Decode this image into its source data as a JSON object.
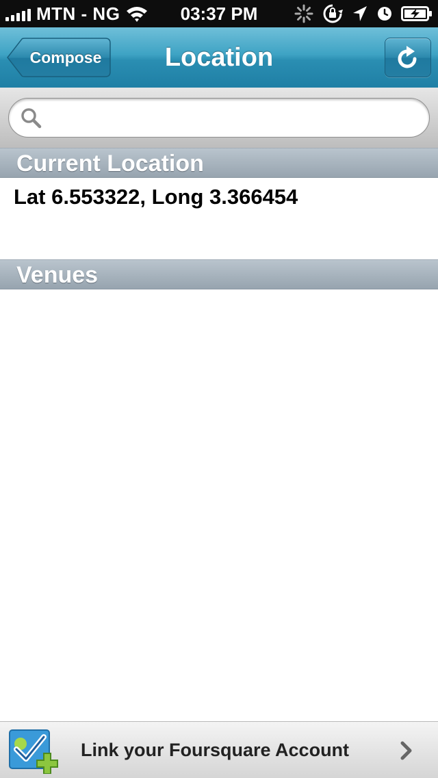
{
  "status_bar": {
    "carrier": "MTN - NG",
    "time": "03:37 PM",
    "icons": [
      "signal-bars-icon",
      "wifi-icon",
      "activity-spinner-icon",
      "rotation-lock-icon",
      "location-arrow-icon",
      "alarm-clock-icon",
      "battery-charging-icon"
    ]
  },
  "nav": {
    "title": "Location",
    "back_label": "Compose",
    "refresh_icon": "refresh-icon"
  },
  "search": {
    "placeholder": "",
    "value": ""
  },
  "sections": {
    "current_location": {
      "header": "Current Location",
      "text": "Lat 6.553322, Long 3.366454"
    },
    "venues": {
      "header": "Venues",
      "items": []
    }
  },
  "footer": {
    "link_label": "Link your Foursquare Account",
    "icon": "foursquare-add-icon",
    "chevron": "chevron-right-icon"
  },
  "colors": {
    "nav_bar": "#2a8eb2",
    "section_header": "#a5b1bb",
    "status_bar": "#0d0d0d"
  }
}
